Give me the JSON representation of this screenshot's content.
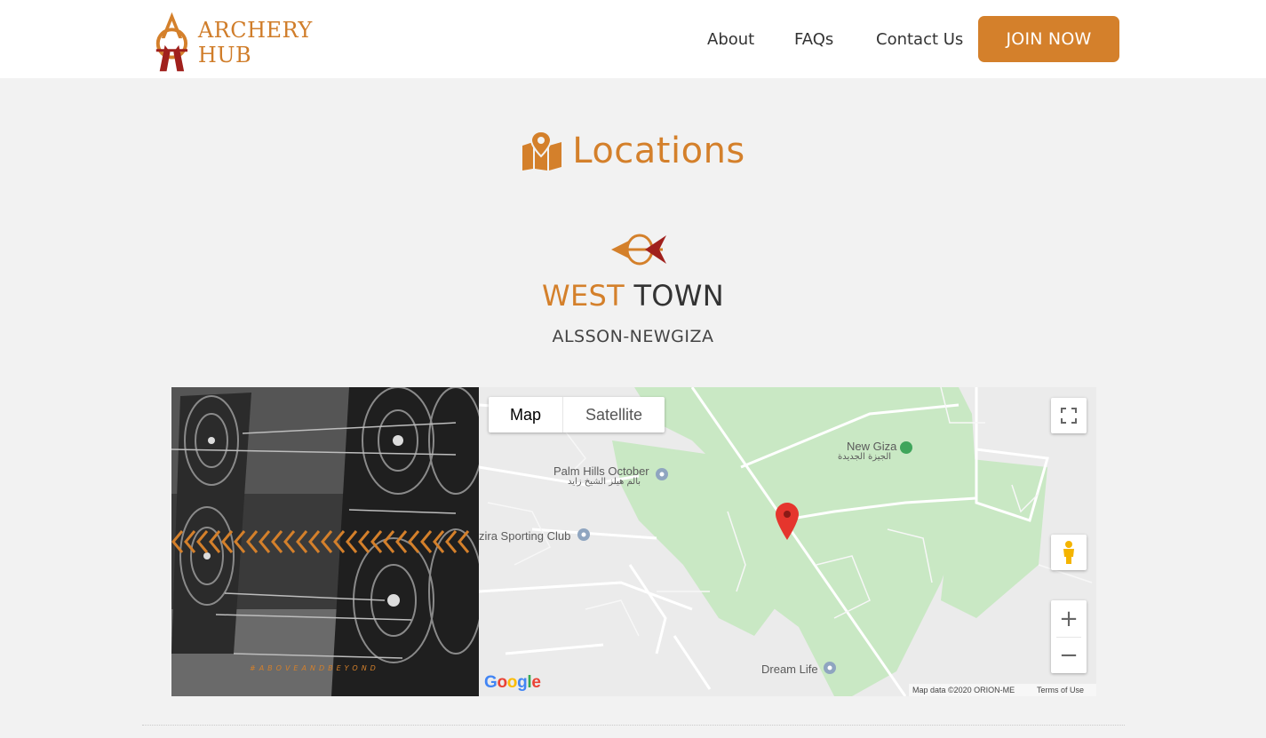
{
  "header": {
    "logo_text": "ARCHERY HUB",
    "nav": [
      "About",
      "FAQs",
      "Contact Us"
    ],
    "cta": "JOIN NOW"
  },
  "section": {
    "title": "Locations"
  },
  "location": {
    "name_part1": "WEST",
    "name_part2": "TOWN",
    "subtitle": "ALSSON-NEWGIZA",
    "photo_tag": "#ABOVEANDBEYOND"
  },
  "map": {
    "type_map": "Map",
    "type_satellite": "Satellite",
    "labels": {
      "new_giza": "New Giza",
      "new_giza_ar": "الجيزة الجديدة",
      "palm_hills": "Palm Hills October",
      "palm_hills_ar": "بالم هيلز الشيخ زايد",
      "sporting_club": "zira Sporting Club",
      "dream_life": "Dream Life"
    },
    "zoom_in": "+",
    "zoom_out": "−",
    "logo": "Google",
    "attribution": "Map data ©2020 ORION-ME",
    "terms": "Terms of Use"
  },
  "colors": {
    "accent": "#d4802b",
    "park": "#c9e8c4",
    "marker": "#e5352d"
  }
}
